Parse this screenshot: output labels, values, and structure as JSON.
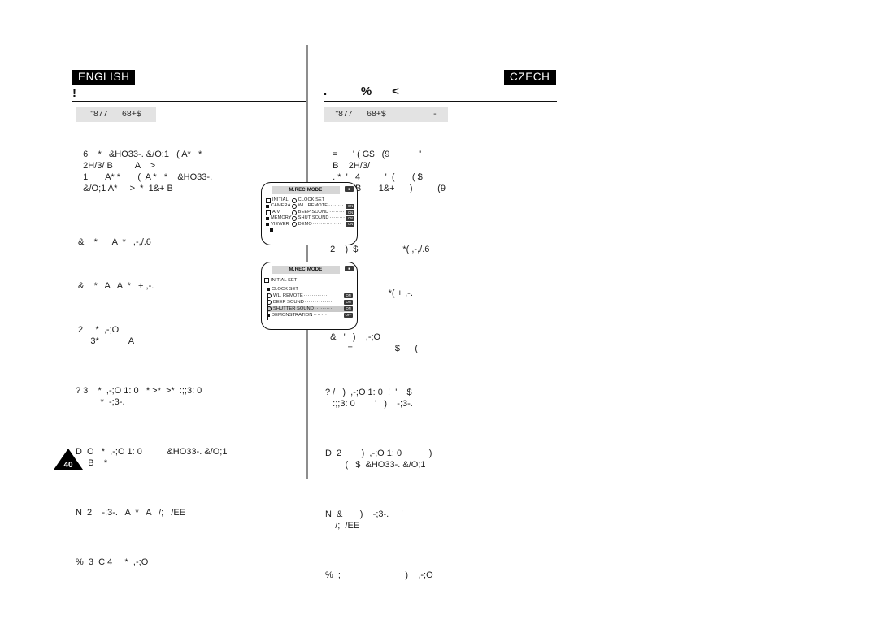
{
  "page": {
    "number": "40",
    "left_language": "ENGLISH",
    "right_language": "CZECH",
    "left_title": "!",
    "right_title": ".          %      <",
    "left_section_bar": "\"877      68+$",
    "right_section_bar": "\"877      68+$                    -"
  },
  "left_column": {
    "paragraphs": [
      "   6    *   &HO33-. &/O;1   ( A*   *\n   2H/3/ B         A    >\n   1       A* *       (  A *   *    &HO33-.\n   &/O;1 A*     >  *  1&+ B",
      " &    *      A  *   ,-,/.6",
      " &    *   A   A  *   + ,-.",
      " 2     *  ,-;O\n      3*            A",
      "? 3    *  ,-;O 1: 0   * >*  >*  :;;3: 0\n          *  -;3-.",
      "D  O   *  ,-;O 1: 0          &HO33-. &/O;1\n     B    *",
      "N  2    -;3-.   A  *   A   /;   /EE",
      "%  3  C 4     *  ,-;O"
    ]
  },
  "right_column": {
    "paragraphs": [
      "   =      ' ( G$   (9            '\n   B    2H/3/\n   . *  '   4          '  (       ( $\n      >    B       1&+      )          (9\n       ' (",
      "  2    )  $                  *( ,-,/.6",
      "  #(  )                 *( + ,-.",
      "  &   '   )    ,-;O\n         =                 $      (",
      "? /   )  ,-;O 1: 0  !  '    $\n   :;;3: 0        '   )    -;3-.",
      "D  2        )  ,-;O 1: 0           )\n        (   $  &HO33-. &/O;1",
      "N  &       )    -;3-.     '\n    /;  /EE",
      "%  ;                          )    ,-;O"
    ]
  },
  "lcd_screens": [
    {
      "id": "mrec-mode-main",
      "title": "M.REC MODE",
      "badge": "■",
      "left_items": [
        {
          "marker": "hollow",
          "label": "INITIAL"
        },
        {
          "marker": "solid",
          "label": "CAMERA"
        },
        {
          "marker": "x",
          "label": "A/V"
        },
        {
          "marker": "solid",
          "label": "MEMORY"
        },
        {
          "marker": "solid",
          "label": "VIEWER"
        }
      ],
      "right_items": [
        {
          "label": "CLOCK  SET",
          "dots": "",
          "chip": ""
        },
        {
          "label": "WL. REMOTE",
          "dots": "········",
          "chip": "ON"
        },
        {
          "label": "BEEP SOUND",
          "dots": "········",
          "chip": "ON"
        },
        {
          "label": "SHUT SOUND",
          "dots": "········",
          "chip": "ON"
        },
        {
          "label": "DEMO",
          "dots": "···············",
          "chip": "ON"
        }
      ],
      "footer_marker": "■"
    },
    {
      "id": "mrec-mode-initial-set",
      "title": "M.REC MODE",
      "badge": "■",
      "header": "INITIAL SET",
      "items": [
        {
          "marker": "solid",
          "label": "CLOCK  SET",
          "dots": "",
          "chip": "",
          "highlight": false
        },
        {
          "marker": "ring",
          "label": "WL. REMOTE",
          "dots": "············",
          "chip": "ON",
          "highlight": false
        },
        {
          "marker": "ring",
          "label": "BEEP SOUND",
          "dots": "··············",
          "chip": "ON",
          "highlight": false
        },
        {
          "marker": "ring",
          "label": "SHUTTER SOUND",
          "dots": "·········",
          "chip": "ON",
          "highlight": true
        },
        {
          "marker": "solid",
          "label": "DEMONSTRATION",
          "dots": "········",
          "chip": "OFF",
          "highlight": false
        }
      ]
    }
  ],
  "colors": {
    "ink": "#1a1a1a",
    "bar_gray": "#e3e3e3",
    "rule": "#111111",
    "divider": "#8d8d8d",
    "highlight": "#c9c9c9"
  }
}
